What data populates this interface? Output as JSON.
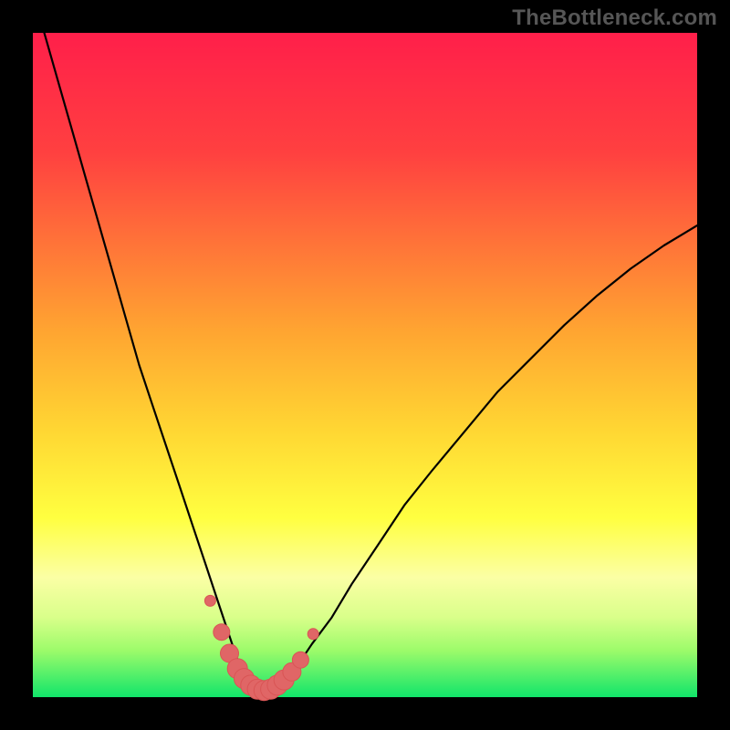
{
  "watermark": {
    "text": "TheBottleneck.com"
  },
  "colors": {
    "frame_bg": "#000000",
    "gradient_stops": [
      {
        "pos": 0,
        "color": "#ff1f4a"
      },
      {
        "pos": 18,
        "color": "#ff4040"
      },
      {
        "pos": 45,
        "color": "#ffa531"
      },
      {
        "pos": 60,
        "color": "#ffd733"
      },
      {
        "pos": 73,
        "color": "#ffff40"
      },
      {
        "pos": 82,
        "color": "#fbffa5"
      },
      {
        "pos": 88,
        "color": "#d9ff8a"
      },
      {
        "pos": 93,
        "color": "#9cfb6a"
      },
      {
        "pos": 100,
        "color": "#11e56a"
      }
    ],
    "curve_stroke": "#000000",
    "marker_fill": "#e06666",
    "marker_stroke": "#d95555"
  },
  "chart_data": {
    "type": "line",
    "title": "",
    "xlabel": "",
    "ylabel": "",
    "xlim": [
      0,
      100
    ],
    "ylim": [
      0,
      100
    ],
    "grid": false,
    "annotations": [
      "TheBottleneck.com"
    ],
    "series": [
      {
        "name": "bottleneck-curve",
        "x": [
          0,
          2,
          4,
          6,
          8,
          10,
          12,
          14,
          16,
          18,
          20,
          22,
          24,
          26,
          28,
          30,
          31,
          32,
          33,
          34,
          35,
          36,
          38,
          40,
          42,
          45,
          48,
          52,
          56,
          60,
          65,
          70,
          75,
          80,
          85,
          90,
          95,
          100
        ],
        "y": [
          106,
          99,
          92,
          85,
          78,
          71,
          64,
          57,
          50,
          44,
          38,
          32,
          26,
          20,
          14,
          8,
          5,
          3,
          1.5,
          1,
          1,
          1.5,
          3,
          5,
          8,
          12,
          17,
          23,
          29,
          34,
          40,
          46,
          51,
          56,
          60.5,
          64.5,
          68,
          71
        ]
      }
    ],
    "markers": {
      "name": "highlight-points",
      "x": [
        26.7,
        28.4,
        29.6,
        30.8,
        31.8,
        32.8,
        33.8,
        34.8,
        35.8,
        36.8,
        37.8,
        39.0,
        40.3,
        42.2
      ],
      "y": [
        14.5,
        9.8,
        6.6,
        4.3,
        2.8,
        1.8,
        1.2,
        1.0,
        1.2,
        1.8,
        2.6,
        3.8,
        5.6,
        9.5
      ],
      "size": [
        6,
        9,
        10,
        11,
        11,
        11,
        11,
        11,
        11,
        11,
        11,
        10,
        9,
        6
      ]
    }
  }
}
